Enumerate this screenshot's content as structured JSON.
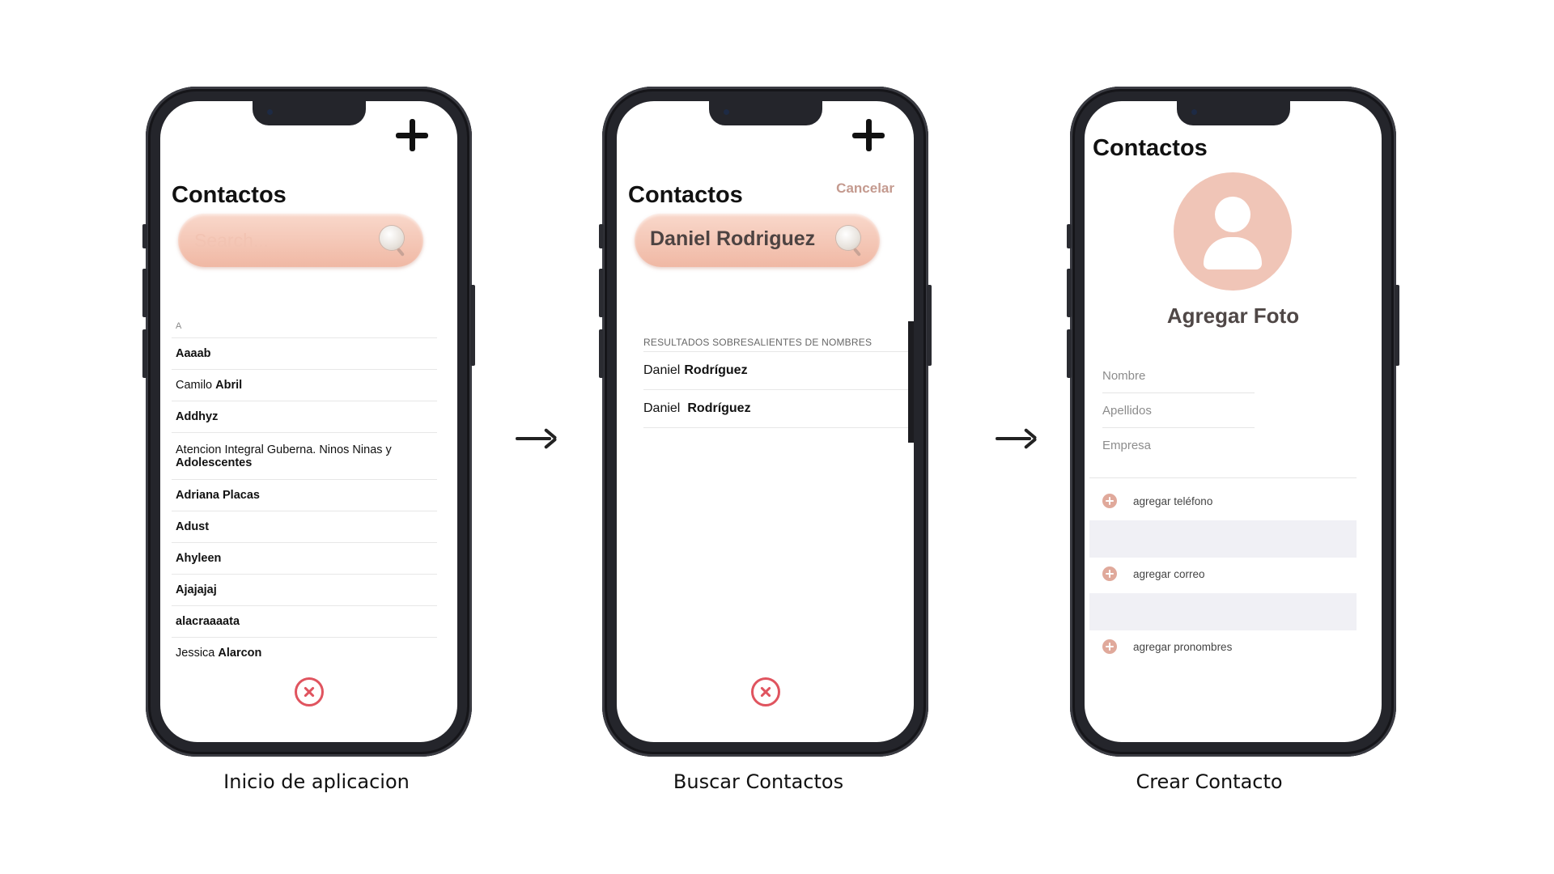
{
  "screen1": {
    "title": "Contactos",
    "search_placeholder": "Search...",
    "section_letter": "A",
    "contacts": [
      {
        "first": "",
        "last": "Aaaab"
      },
      {
        "first": "Camilo ",
        "last": "Abril"
      },
      {
        "first": "",
        "last": "Addhyz"
      },
      {
        "first": "Atencion Integral Guberna. Ninos Ninas y",
        "last": "Adolescentes"
      },
      {
        "first": "",
        "last": "Adriana Placas"
      },
      {
        "first": "",
        "last": "Adust"
      },
      {
        "first": "",
        "last": "Ahyleen"
      },
      {
        "first": "",
        "last": "Ajajajaj"
      },
      {
        "first": "",
        "last": "alacraaaata"
      },
      {
        "first": "Jessica ",
        "last": "Alarcon"
      }
    ],
    "caption": "Inicio de aplicacion"
  },
  "screen2": {
    "title": "Contactos",
    "cancel_label": "Cancelar",
    "search_query": "Daniel Rodriguez",
    "results_header": "RESULTADOS SOBRESALIENTES DE NOMBRES",
    "results": [
      {
        "first": "Daniel",
        "last": "Rodríguez"
      },
      {
        "first": "Daniel",
        "last": "Rodríguez"
      }
    ],
    "caption": "Buscar Contactos"
  },
  "screen3": {
    "title": "Contactos",
    "add_photo": "Agregar Foto",
    "fields": [
      "Nombre",
      "Apellidos",
      "Empresa"
    ],
    "add_rows": [
      "agregar teléfono",
      "agregar correo",
      "agregar pronombres"
    ],
    "caption": "Crear Contacto"
  },
  "colors": {
    "accent": "#f0b8a4",
    "close": "#e0545f",
    "add_circle": "#e0a99b",
    "cancel": "#c49a8f",
    "phone_frame": "#24252b"
  },
  "icons": [
    "plus-icon",
    "magnifier-icon",
    "close-icon",
    "avatar-icon",
    "add-circle-icon",
    "arrow-right-icon"
  ]
}
